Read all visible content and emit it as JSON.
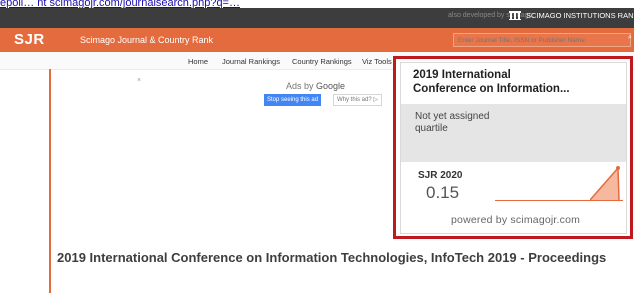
{
  "url_line": "epoli… nt scimagojr.com/journalsearch.php?q=…",
  "top_bar": {
    "also_developed": "also developed by scimago:",
    "sir_link": "SCIMAGO INSTITUTIONS RANKINGS"
  },
  "header": {
    "logo": "SJR",
    "site_title": "Scimago Journal & Country Rank",
    "search_placeholder": "Enter Journal Title, ISSN or Publisher Name"
  },
  "nav": {
    "items": [
      "Home",
      "Journal Rankings",
      "Country Rankings",
      "Viz Tools"
    ]
  },
  "ad": {
    "close_glyph": "×",
    "ads_by": "Ads by",
    "ads_brand": "Google",
    "stop_label": "Stop seeing this ad",
    "why_label": "Why this ad? ▷"
  },
  "widget": {
    "title_line1": "2019 International",
    "title_line2": "Conference on Information...",
    "quartile_line1": "Not yet assigned",
    "quartile_line2": "quartile",
    "sjr_label": "SJR 2020",
    "sjr_value": "0.15",
    "powered_by": "powered by scimagojr.com",
    "accent_color": "#e46b3e",
    "frame_color": "#c0181f"
  },
  "page": {
    "title": "2019 International Conference on Information Technologies, InfoTech 2019 - Proceedings"
  }
}
